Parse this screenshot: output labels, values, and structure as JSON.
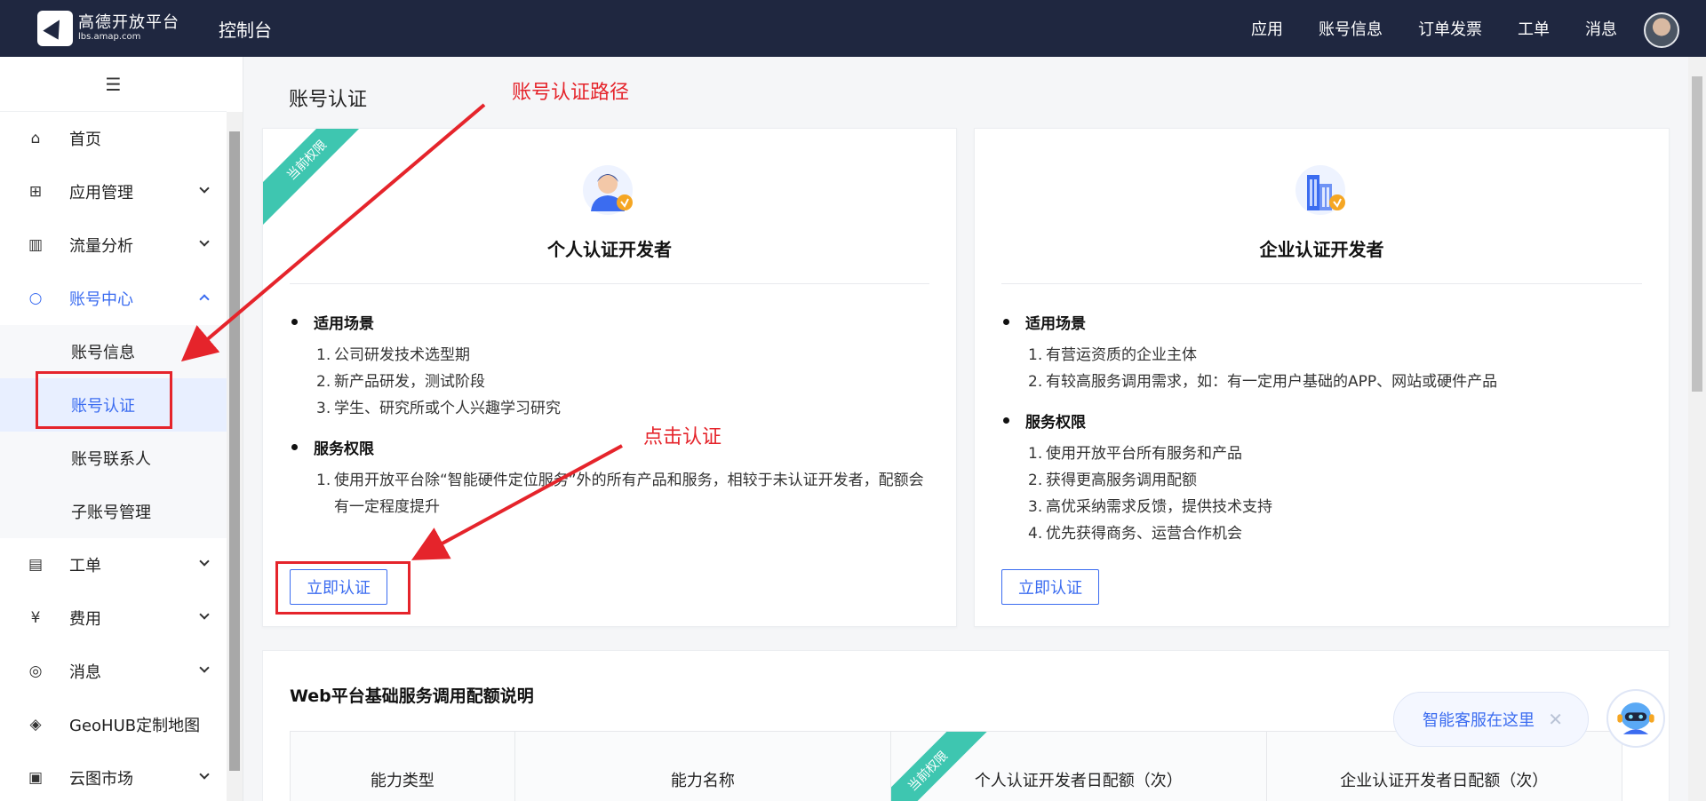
{
  "topbar": {
    "logo_title": "高德开放平台",
    "logo_sub": "lbs.amap.com",
    "console": "控制台",
    "nav": [
      "应用",
      "账号信息",
      "订单发票",
      "工单",
      "消息"
    ]
  },
  "sidebar": {
    "toggle": "☰",
    "items": [
      {
        "label": "首页",
        "icon": "home-icon"
      },
      {
        "label": "应用管理",
        "icon": "grid-icon"
      },
      {
        "label": "流量分析",
        "icon": "chart-icon"
      },
      {
        "label": "账号中心",
        "icon": "user-icon"
      },
      {
        "label": "账号信息"
      },
      {
        "label": "账号认证"
      },
      {
        "label": "账号联系人"
      },
      {
        "label": "子账号管理"
      },
      {
        "label": "工单",
        "icon": "ticket-icon"
      },
      {
        "label": "费用",
        "icon": "yen-icon"
      },
      {
        "label": "消息",
        "icon": "message-icon"
      },
      {
        "label": "GeoHUB定制地图",
        "icon": "layers-icon"
      },
      {
        "label": "云图市场",
        "icon": "store-icon"
      }
    ]
  },
  "page": {
    "title": "账号认证"
  },
  "annotations": {
    "path": "账号认证路径",
    "click": "点击认证"
  },
  "personal": {
    "ribbon": "当前权限",
    "title": "个人认证开发者",
    "sec1": "适用场景",
    "scenarios": [
      "公司研发技术选型期",
      "新产品研发，测试阶段",
      "学生、研究所或个人兴趣学习研究"
    ],
    "sec2": "服务权限",
    "perms": [
      "使用开放平台除“智能硬件定位服务”外的所有产品和服务，相较于未认证开发者，配额会有一定程度提升"
    ],
    "button": "立即认证"
  },
  "enterprise": {
    "title": "企业认证开发者",
    "sec1": "适用场景",
    "scenarios": [
      "有营运资质的企业主体",
      "有较高服务调用需求，如：有一定用户基础的APP、网站或硬件产品"
    ],
    "sec2": "服务权限",
    "perms": [
      "使用开放平台所有服务和产品",
      "获得更高服务调用配额",
      "高优采纳需求反馈，提供技术支持",
      "优先获得商务、运营合作机会"
    ],
    "button": "立即认证"
  },
  "quota": {
    "title": "Web平台基础服务调用配额说明",
    "ribbon": "当前权限",
    "headers": [
      "能力类型",
      "能力名称",
      "个人认证开发者日配额（次）",
      "企业认证开发者日配额（次）"
    ]
  },
  "chat": {
    "label": "智能客服在这里",
    "close": "✕"
  },
  "colors": {
    "accent": "#3b6cf0",
    "topbar": "#1f2740",
    "ribbon": "#3ec6b0",
    "annotation": "#e5242b"
  }
}
